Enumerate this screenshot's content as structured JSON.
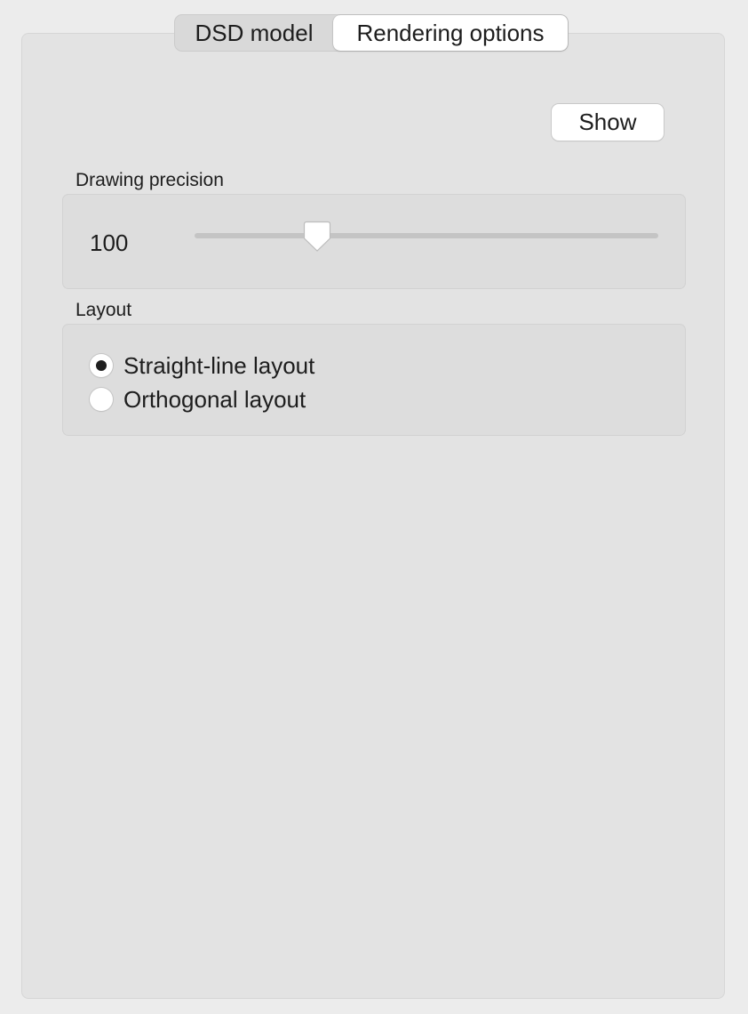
{
  "tabs": [
    {
      "label": "DSD model",
      "selected": false
    },
    {
      "label": "Rendering options",
      "selected": true
    }
  ],
  "show_button": {
    "label": "Show"
  },
  "drawing_precision": {
    "label": "Drawing precision",
    "value": "100",
    "slider_fraction": 0.265
  },
  "layout": {
    "label": "Layout",
    "options": [
      {
        "label": "Straight-line layout",
        "checked": true
      },
      {
        "label": "Orthogonal layout",
        "checked": false
      }
    ]
  }
}
